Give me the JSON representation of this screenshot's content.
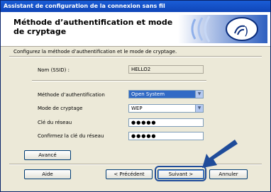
{
  "window": {
    "title": "Assistant de configuration de la connexion sans fil"
  },
  "header": {
    "title": "Méthode d’authentification et mode de cryptage",
    "graphic_icon": "wireless-signal-icon"
  },
  "instruction": "Configurez la méthode d’authentification et le mode de cryptage.",
  "ssid": {
    "label": "Nom (SSID) :",
    "value": "HELLO2"
  },
  "auth_method": {
    "label": "Méthode d’authentification",
    "value": "Open System"
  },
  "encryption_mode": {
    "label": "Mode de cryptage",
    "value": "WEP"
  },
  "network_key": {
    "label": "Clé du réseau",
    "value": "●●●●●"
  },
  "confirm_key": {
    "label": "Confirmez la clé du réseau",
    "value": "●●●●●"
  },
  "buttons": {
    "advanced": "Avancé",
    "help": "Aide",
    "previous": "< Précédent",
    "next": "Suivant >",
    "cancel": "Annuler"
  },
  "colors": {
    "title_bar": "#0f45b8",
    "accent": "#1f4c9a",
    "window_bg": "#ece9d8"
  }
}
